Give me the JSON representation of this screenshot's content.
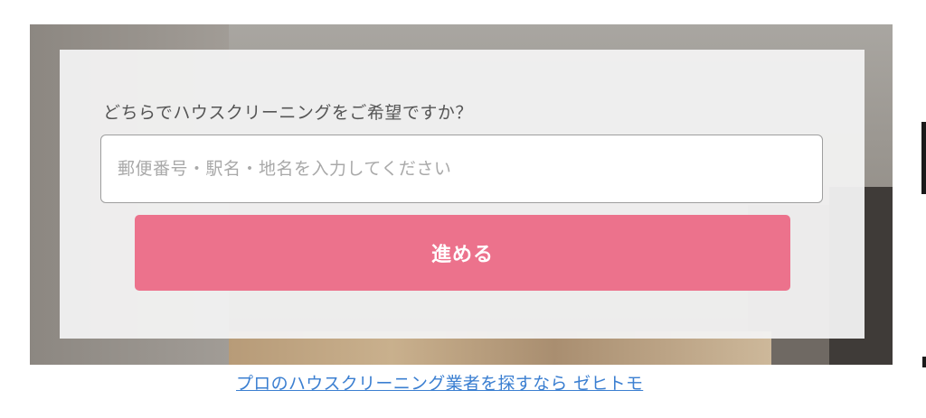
{
  "form": {
    "question": "どちらでハウスクリーニングをご希望ですか？",
    "input_value": "",
    "input_placeholder": "郵便番号・駅名・地名を入力してください",
    "submit_label": "進める"
  },
  "footer": {
    "link_text": "プロのハウスクリーニング業者を探すなら ゼヒトモ"
  },
  "colors": {
    "button": "#ec728c",
    "link": "#3b7fd1",
    "panel": "#f2f2f2"
  }
}
